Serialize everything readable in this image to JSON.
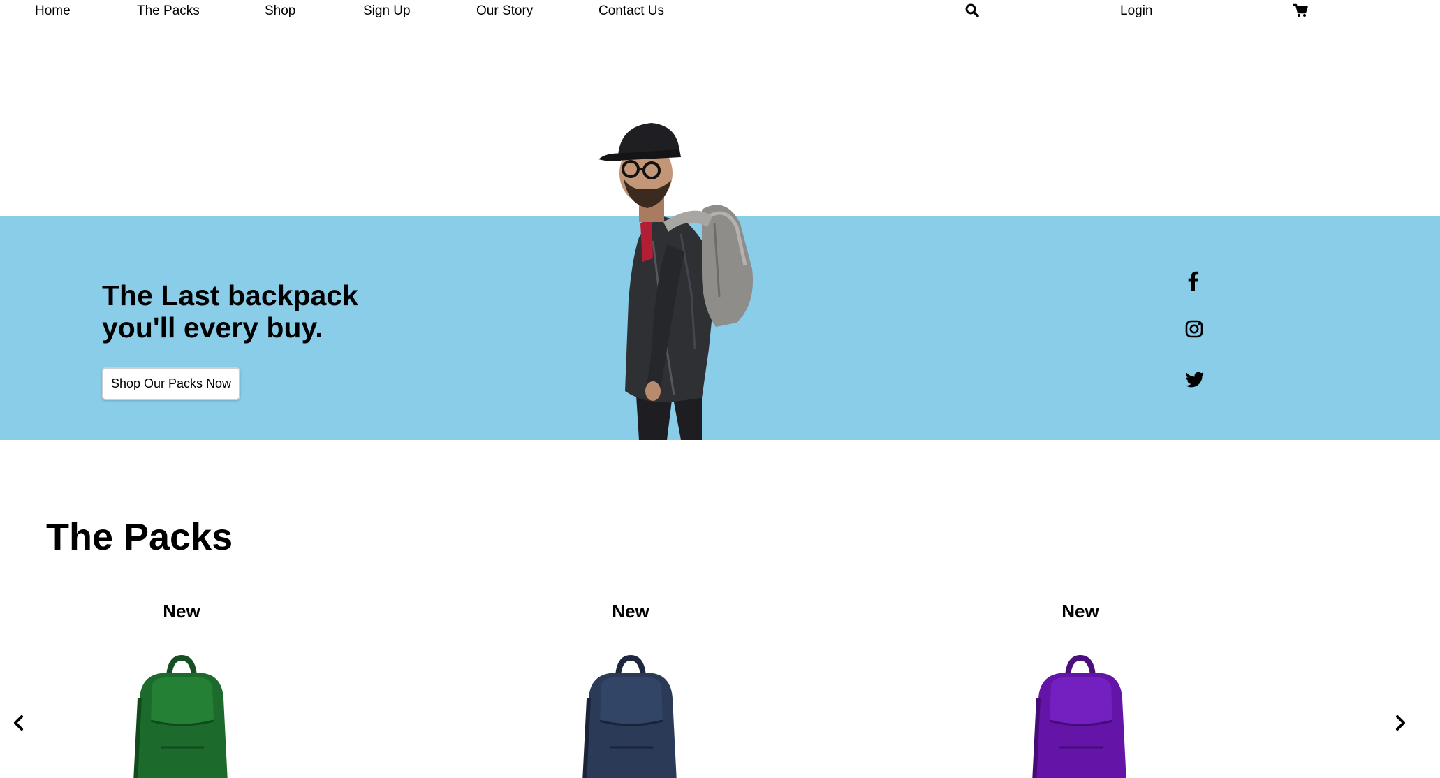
{
  "nav": {
    "items": [
      "Home",
      "The Packs",
      "Shop",
      "Sign Up",
      "Our Story",
      "Contact Us"
    ],
    "login": "Login",
    "search_icon": "search-icon",
    "cart_icon": "cart-icon"
  },
  "hero": {
    "title_line1": "The Last backpack",
    "title_line2": "you'll every buy.",
    "cta": "Shop Our Packs Now",
    "band_color": "#89cde9"
  },
  "social": [
    "facebook-icon",
    "instagram-icon",
    "twitter-icon"
  ],
  "packs": {
    "heading": "The Packs",
    "items": [
      {
        "badge": "New",
        "color": "#1d6b2c"
      },
      {
        "badge": "New",
        "color": "#2b3a57"
      },
      {
        "badge": "New",
        "color": "#6514a8"
      }
    ]
  }
}
